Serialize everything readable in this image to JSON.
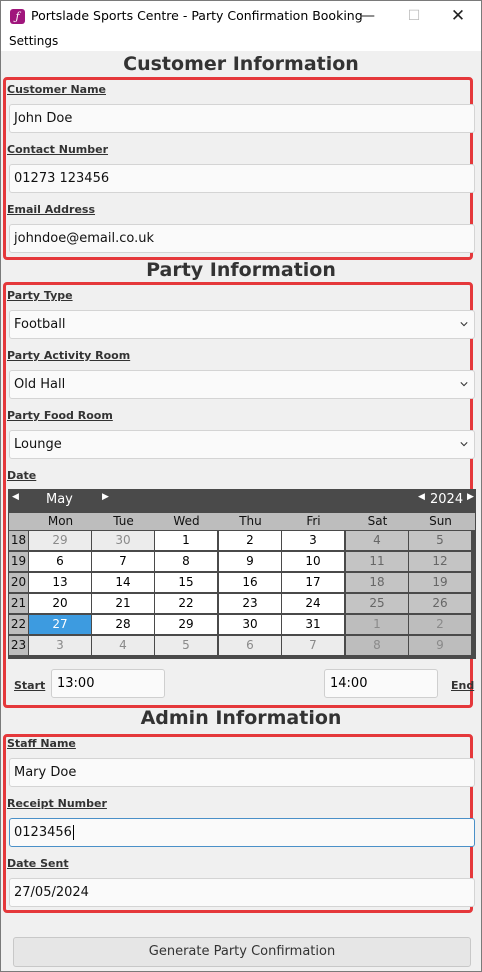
{
  "window": {
    "title": "Portslade Sports Centre - Party Confirmation Booking"
  },
  "menu": {
    "settings": "Settings"
  },
  "customer": {
    "title": "Customer Information",
    "name_label": "Customer Name",
    "name_value": "John Doe",
    "contact_label": "Contact Number",
    "contact_value": "01273 123456",
    "email_label": "Email Address",
    "email_value": "johndoe@email.co.uk"
  },
  "party": {
    "title": "Party Information",
    "type_label": "Party Type",
    "type_value": "Football",
    "activity_label": "Party Activity Room",
    "activity_value": "Old Hall",
    "food_label": "Party Food Room",
    "food_value": "Lounge",
    "date_label": "Date",
    "calendar": {
      "month": "May",
      "year": "2024",
      "days_of_week": [
        "Mon",
        "Tue",
        "Wed",
        "Thu",
        "Fri",
        "Sat",
        "Sun"
      ],
      "selected": "27",
      "weeks": [
        {
          "week": "18",
          "days": [
            "29",
            "30",
            "1",
            "2",
            "3",
            "4",
            "5"
          ],
          "other": [
            true,
            true,
            false,
            false,
            false,
            false,
            false
          ]
        },
        {
          "week": "19",
          "days": [
            "6",
            "7",
            "8",
            "9",
            "10",
            "11",
            "12"
          ],
          "other": [
            false,
            false,
            false,
            false,
            false,
            false,
            false
          ]
        },
        {
          "week": "20",
          "days": [
            "13",
            "14",
            "15",
            "16",
            "17",
            "18",
            "19"
          ],
          "other": [
            false,
            false,
            false,
            false,
            false,
            false,
            false
          ]
        },
        {
          "week": "21",
          "days": [
            "20",
            "21",
            "22",
            "23",
            "24",
            "25",
            "26"
          ],
          "other": [
            false,
            false,
            false,
            false,
            false,
            false,
            false
          ]
        },
        {
          "week": "22",
          "days": [
            "27",
            "28",
            "29",
            "30",
            "31",
            "1",
            "2"
          ],
          "other": [
            false,
            false,
            false,
            false,
            false,
            true,
            true
          ]
        },
        {
          "week": "23",
          "days": [
            "3",
            "4",
            "5",
            "6",
            "7",
            "8",
            "9"
          ],
          "other": [
            true,
            true,
            true,
            true,
            true,
            true,
            true
          ]
        }
      ]
    },
    "start_label": "Start",
    "start_value": "13:00",
    "end_label": "End",
    "end_value": "14:00"
  },
  "admin": {
    "title": "Admin Information",
    "staff_label": "Staff Name",
    "staff_value": "Mary Doe",
    "receipt_label": "Receipt Number",
    "receipt_value": "0123456",
    "date_label": "Date Sent",
    "date_value": "27/05/2024"
  },
  "actions": {
    "generate": "Generate Party Confirmation"
  },
  "colors": {
    "frame": "#e5383b",
    "selected_day": "#3d9be0",
    "calendar_dark": "#4a4a4a"
  }
}
